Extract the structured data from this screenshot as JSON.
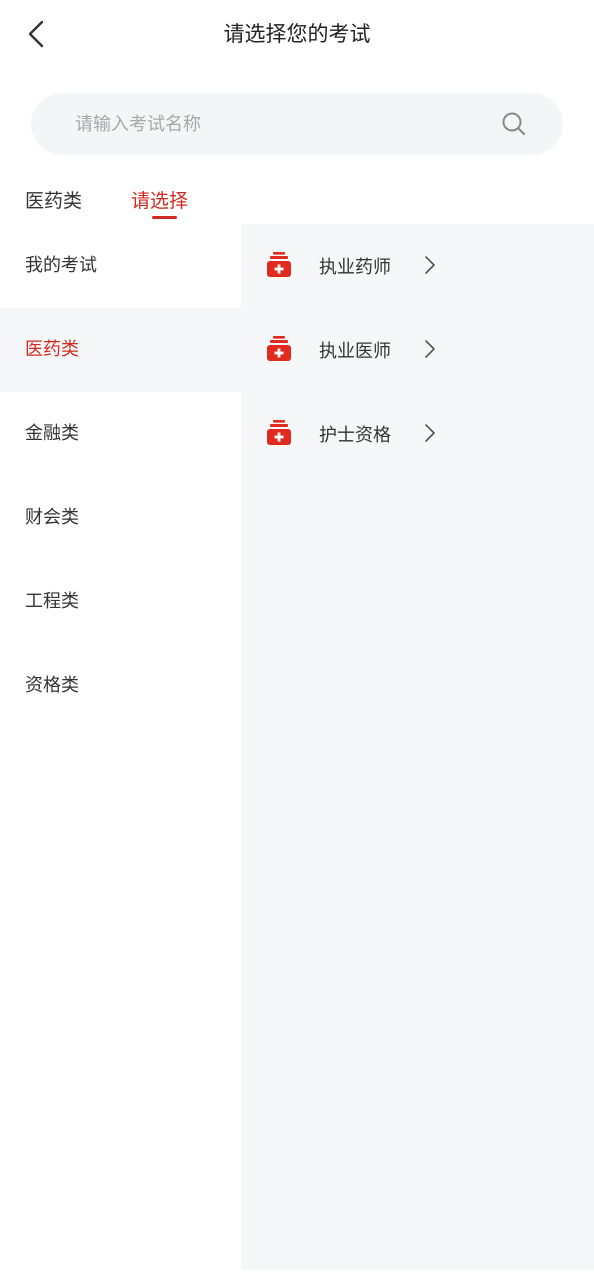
{
  "header": {
    "title": "请选择您的考试"
  },
  "search": {
    "placeholder": "请输入考试名称",
    "value": ""
  },
  "breadcrumb": {
    "items": [
      "医药类",
      "请选择"
    ],
    "active_index": 1
  },
  "sidebar": {
    "items": [
      {
        "label": "我的考试"
      },
      {
        "label": "医药类"
      },
      {
        "label": "金融类"
      },
      {
        "label": "财会类"
      },
      {
        "label": "工程类"
      },
      {
        "label": "资格类"
      }
    ],
    "active_index": 1
  },
  "exams": {
    "items": [
      {
        "label": "执业药师",
        "icon": "medical-kit-icon"
      },
      {
        "label": "执业医师",
        "icon": "medical-kit-icon"
      },
      {
        "label": "护士资格",
        "icon": "medical-kit-icon"
      }
    ]
  },
  "colors": {
    "accent": "#d02a1e",
    "panel_bg": "#f6f7f9",
    "search_bg": "#f4f5f7"
  }
}
